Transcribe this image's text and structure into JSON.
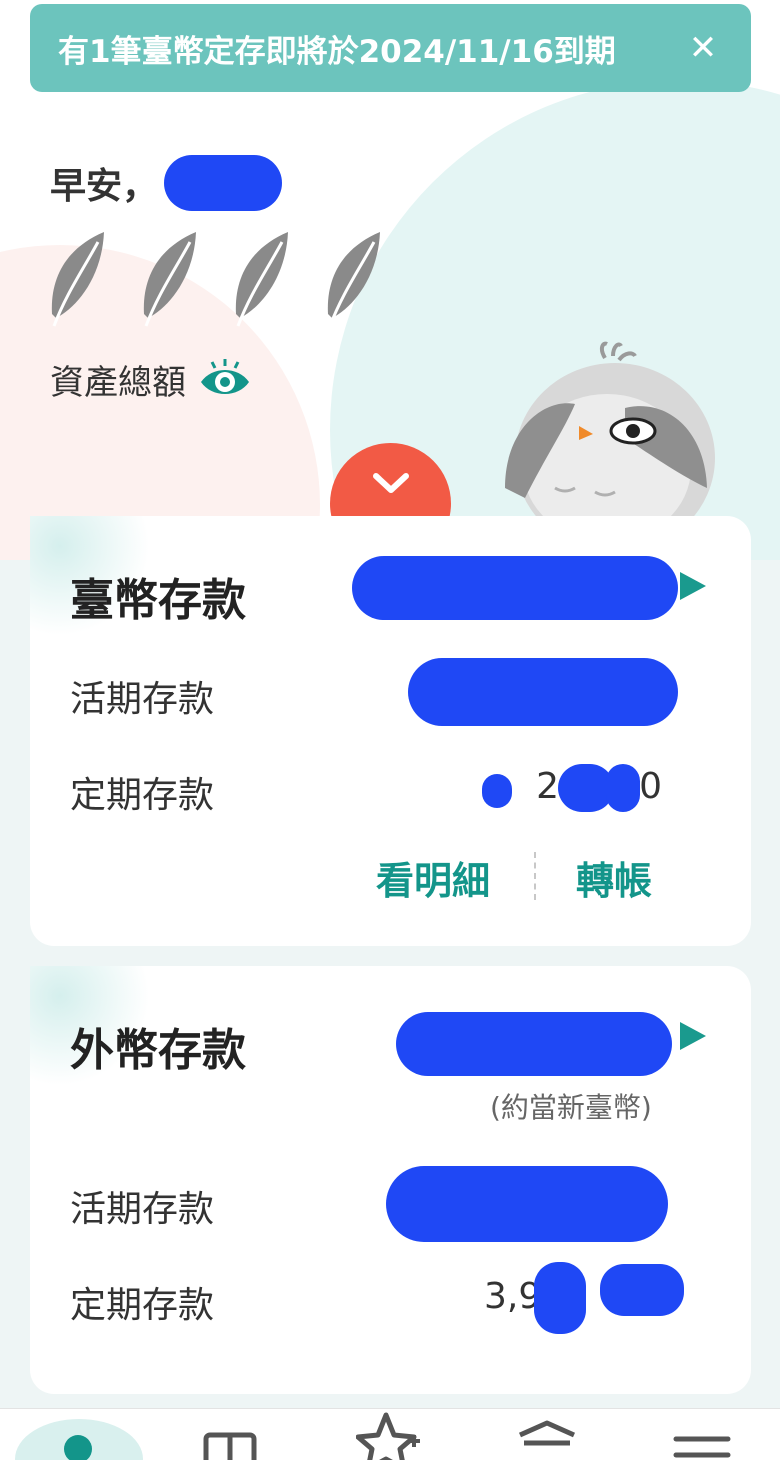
{
  "banner": {
    "text": "有1筆臺幣定存即將於2024/11/16到期",
    "close_label": "✕"
  },
  "greeting": {
    "text": "早安，"
  },
  "assets": {
    "label": "資產總額"
  },
  "twd_card": {
    "title": "臺幣存款",
    "demand_label": "活期存款",
    "time_label": "定期存款",
    "time_amount_visible": "2 ,5 , 0",
    "details_link": "看明細",
    "transfer_link": "轉帳"
  },
  "fx_card": {
    "title": "外幣存款",
    "note": "(約當新臺幣)",
    "demand_label": "活期存款",
    "time_label": "定期存款",
    "time_amount_visible": "3,9"
  },
  "bottom_nav": {
    "items": [
      "home-icon",
      "gift-icon",
      "star-plus-icon",
      "bank-icon",
      "menu-icon"
    ]
  },
  "colors": {
    "accent": "#13958a",
    "banner": "#6cc4bd",
    "expand": "#f25a45",
    "redaction": "#1f48f5"
  }
}
